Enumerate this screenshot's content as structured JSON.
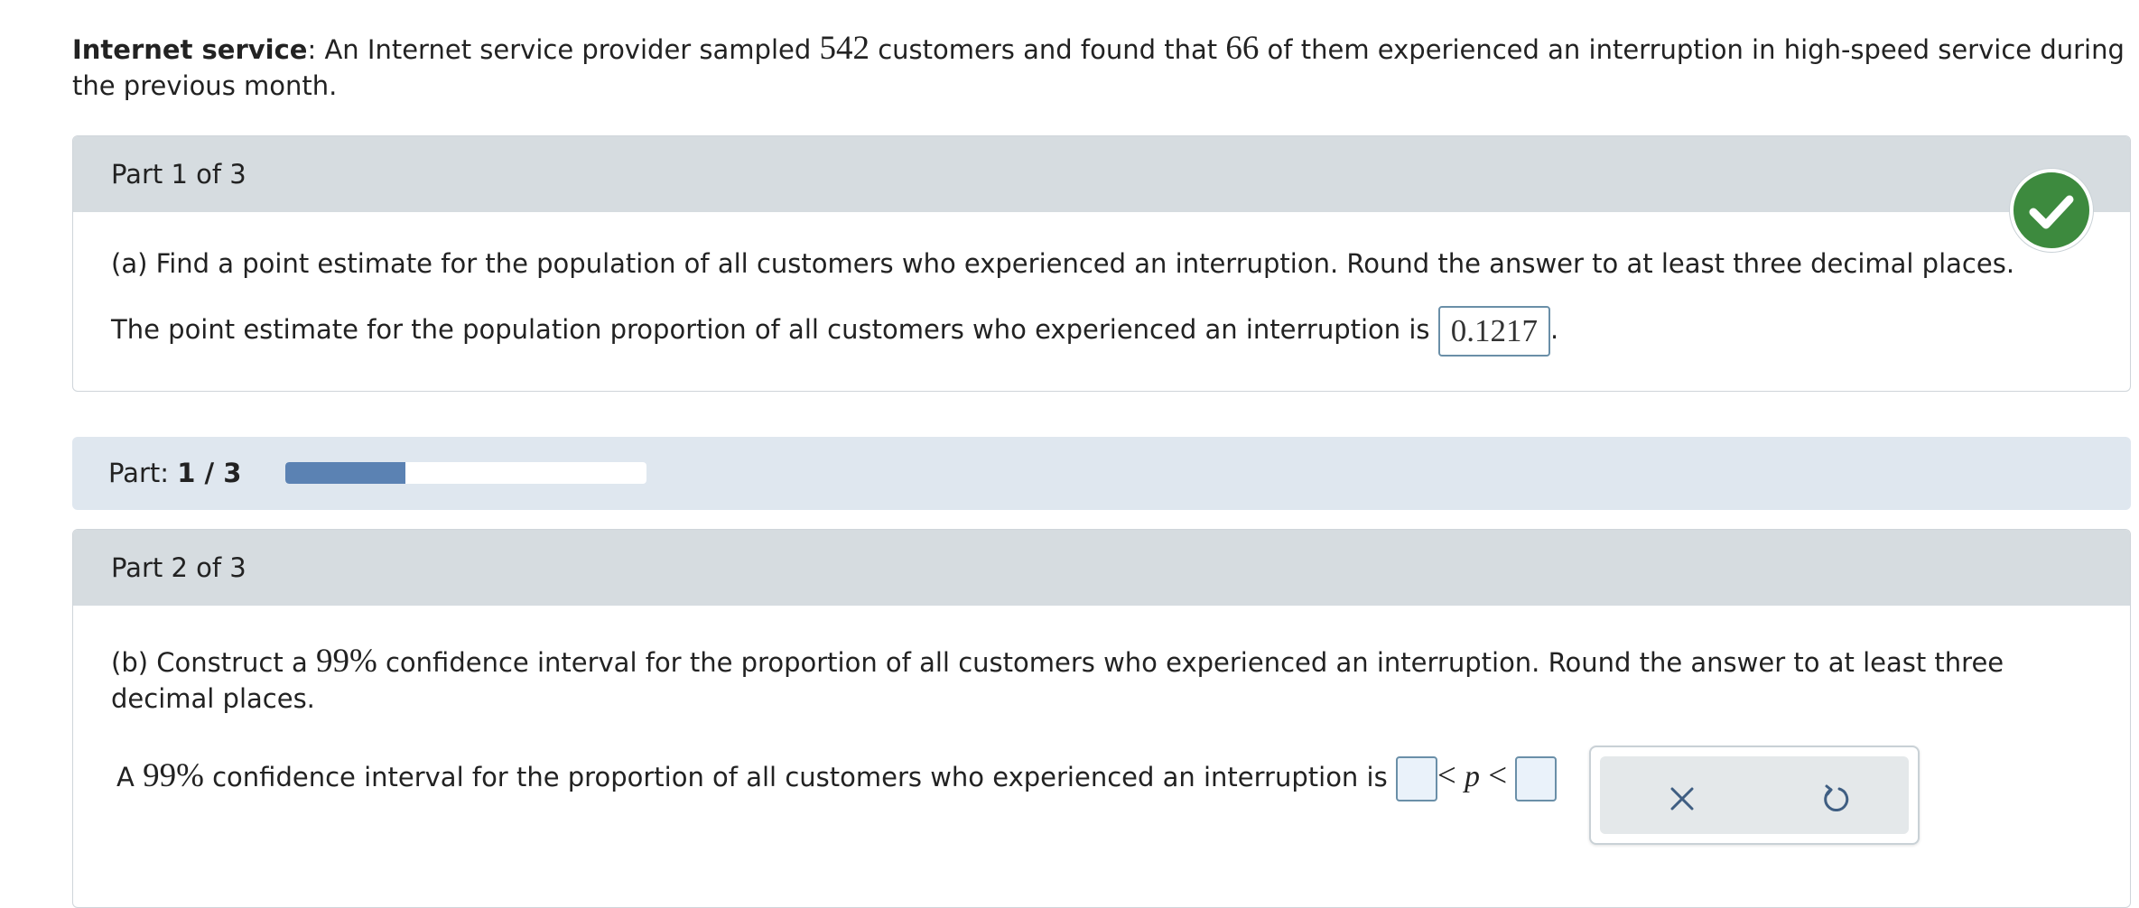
{
  "intro": {
    "title": "Internet service",
    "text_1": ": An Internet service provider sampled ",
    "sample_size": "542",
    "text_2": " customers and found that ",
    "count": "66",
    "text_3": " of them experienced an interruption in high-speed service during the previous month."
  },
  "part1": {
    "header": "Part 1 of 3",
    "question": "(a) Find a point estimate for the population of all customers who experienced an interruption. Round the answer to at least three decimal places.",
    "answer_prefix": "The point estimate for the population proportion of all customers who experienced an interruption is ",
    "answer_value": "0.1217",
    "answer_suffix": ".",
    "status_icon": "check-icon",
    "status_color": "#3d8a3e"
  },
  "progress": {
    "label": "Part:",
    "value": "1 / 3",
    "fraction": 0.3333,
    "fill_color": "#5b82b3"
  },
  "part2": {
    "header": "Part 2 of 3",
    "question_1": "(b) Construct a ",
    "confidence": "99%",
    "question_2": " confidence interval for the proportion of all customers who experienced an interruption. Round the answer to at least three decimal places.",
    "answer_prefix": "A ",
    "answer_text": " confidence interval for the proportion of all customers who experienced an interruption is ",
    "less_than": "<",
    "variable": "p",
    "lower_value": "",
    "upper_value": ""
  },
  "toolbox": {
    "clear_icon": "close-icon",
    "undo_icon": "undo-icon"
  }
}
